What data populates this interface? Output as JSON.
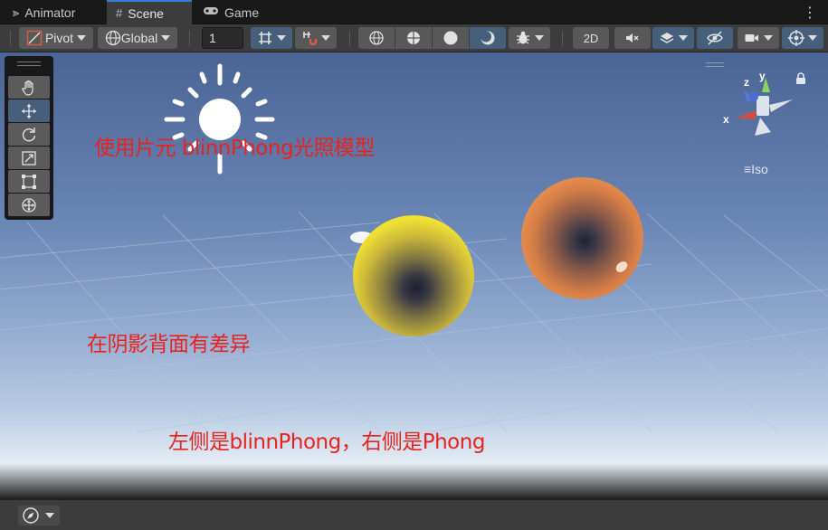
{
  "tabs": [
    {
      "label": "Animator",
      "icon": "animator-icon"
    },
    {
      "label": "Scene",
      "icon": "scene-grid-icon",
      "active": true
    },
    {
      "label": "Game",
      "icon": "gamepad-icon"
    }
  ],
  "toolbar": {
    "pivot_label": "Pivot",
    "global_label": "Global",
    "grid_size_value": "1",
    "mode_2d_label": "2D"
  },
  "scene": {
    "gizmo_axes": {
      "x": "x",
      "y": "y",
      "z": "z"
    },
    "projection_label": "Iso",
    "annotations": {
      "title": "使用片元 blinnPhong光照模型",
      "shadow_note": "在阴影背面有差异",
      "comparison_note": "左侧是blinnPhong，右侧是Phong"
    },
    "sphere_colors": {
      "left": "#f3e63e",
      "right": "#f2a35a"
    }
  },
  "colors": {
    "accent": "#3a7bd5",
    "selected_button": "#46607c",
    "annotation_red": "#e8231f"
  }
}
